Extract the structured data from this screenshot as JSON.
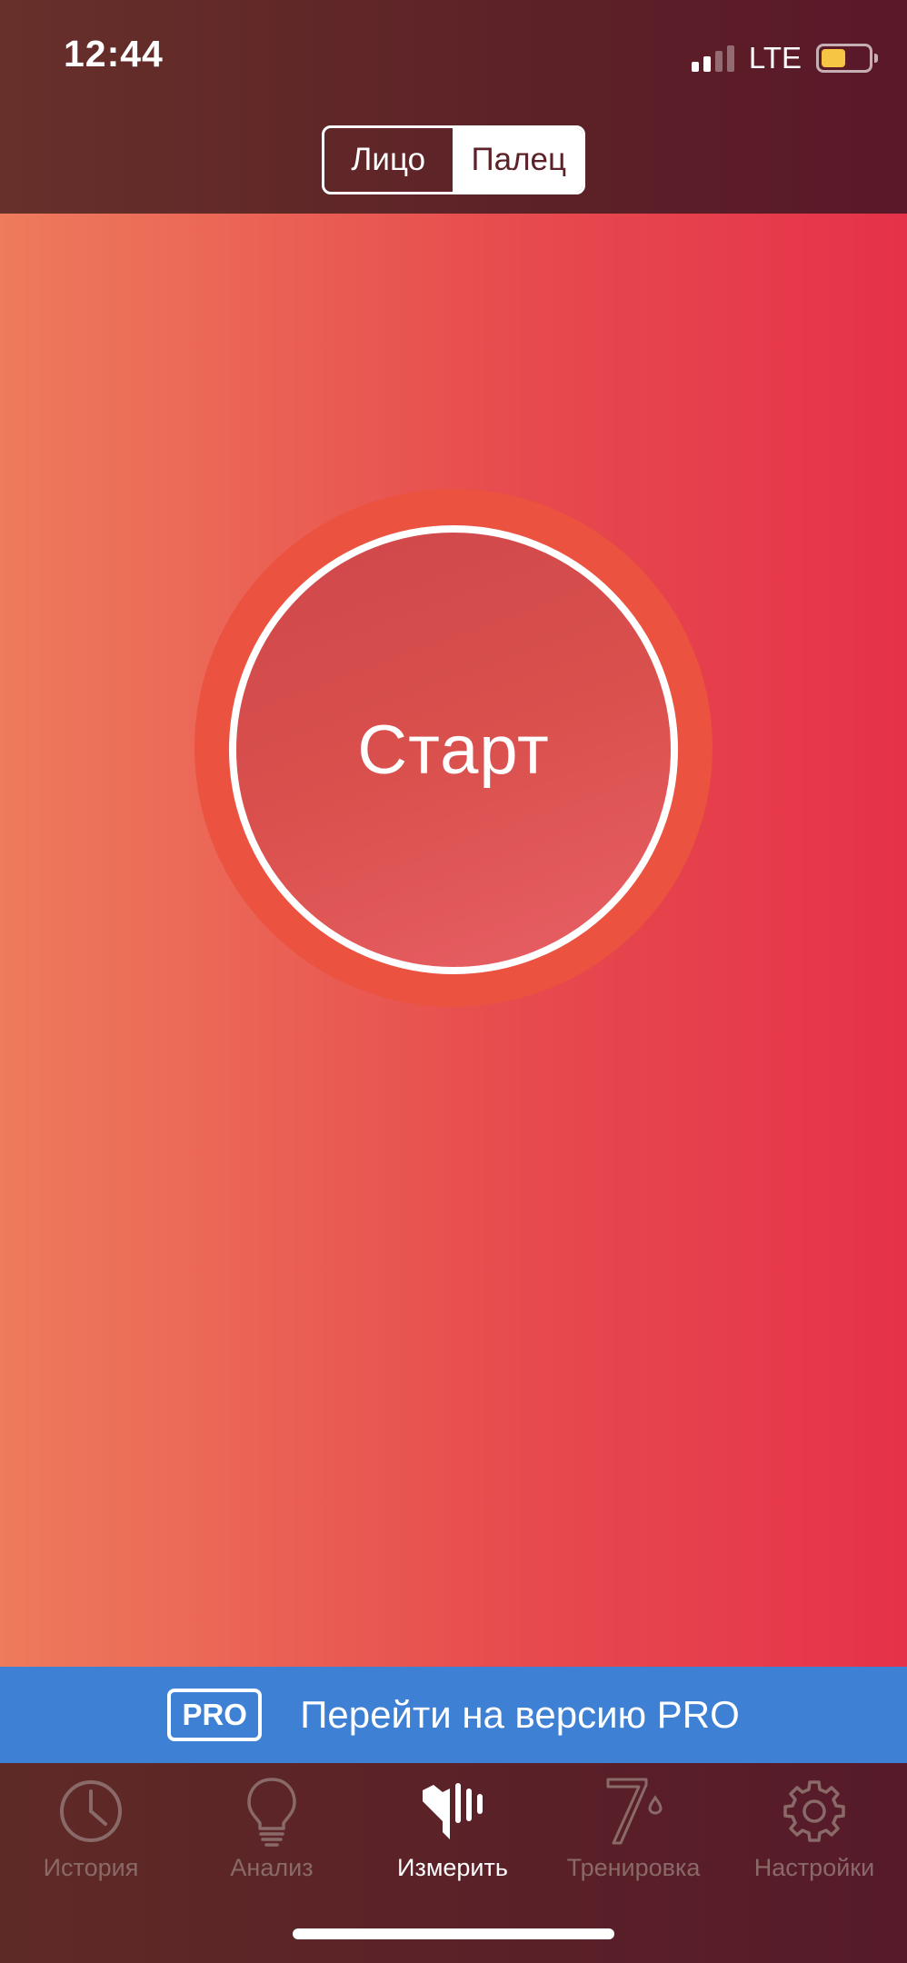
{
  "status_bar": {
    "time": "12:44",
    "network": "LTE",
    "signal_bars_active": 2,
    "signal_bars_total": 4,
    "battery_level": 0.5
  },
  "segmented_control": {
    "options": [
      "Лицо",
      "Палец"
    ],
    "selected": "Палец"
  },
  "main": {
    "start_label": "Старт"
  },
  "pro_banner": {
    "badge": "PRO",
    "text": "Перейти на версию PRO"
  },
  "tabs": [
    {
      "label": "История",
      "icon": "clock-icon",
      "active": false
    },
    {
      "label": "Анализ",
      "icon": "lightbulb-icon",
      "active": false
    },
    {
      "label": "Измерить",
      "icon": "heart-pulse-icon",
      "active": true
    },
    {
      "label": "Тренировка",
      "icon": "seven-drop-icon",
      "active": false
    },
    {
      "label": "Настройки",
      "icon": "gear-icon",
      "active": false
    }
  ],
  "colors": {
    "accent_red": "#e5324a",
    "pro_blue": "#3e80d4",
    "battery_yellow": "#f6c544"
  }
}
